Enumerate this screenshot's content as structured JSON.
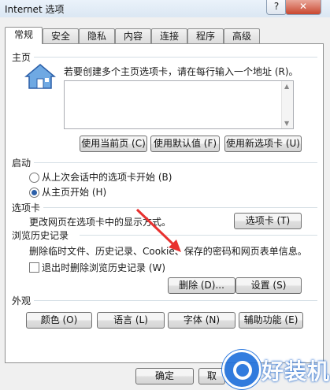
{
  "window": {
    "title": "Internet 选项",
    "help": "?",
    "close": "✕"
  },
  "tabs": [
    "常规",
    "安全",
    "隐私",
    "内容",
    "连接",
    "程序",
    "高级"
  ],
  "home": {
    "group_label": "主页",
    "description": "若要创建多个主页选项卡，请在每行输入一个地址 (R)。",
    "textarea_value": "",
    "buttons": {
      "current": "使用当前页 (C)",
      "default": "使用默认值 (F)",
      "new_tab": "使用新选项卡 (U)"
    }
  },
  "startup": {
    "group_label": "启动",
    "options": [
      "从上次会话中的选项卡开始 (B)",
      "从主页开始 (H)"
    ],
    "selected_index": 1
  },
  "tabs_section": {
    "group_label": "选项卡",
    "description": "更改网页在选项卡中的显示方式。",
    "button": "选项卡 (T)"
  },
  "history": {
    "group_label": "浏览历史记录",
    "description": "删除临时文件、历史记录、Cookie、保存的密码和网页表单信息。",
    "checkbox_label": "退出时删除浏览历史记录 (W)",
    "checkbox_checked": false,
    "delete_button": "删除 (D)...",
    "settings_button": "设置 (S)"
  },
  "appearance": {
    "group_label": "外观",
    "buttons": [
      "颜色 (O)",
      "语言 (L)",
      "字体 (N)",
      "辅助功能 (E)"
    ]
  },
  "footer": {
    "ok": "确定",
    "cancel": "取"
  },
  "watermark": {
    "text": "好装机"
  },
  "colors": {
    "arrow": "#e8312f",
    "accent": "#2b5fa8"
  }
}
